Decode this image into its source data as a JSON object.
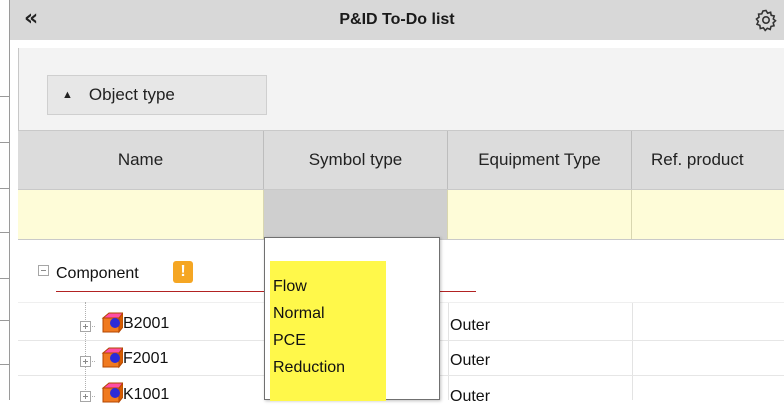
{
  "titlebar": {
    "title": "P&ID To-Do list",
    "collapse_icon": "«",
    "settings_icon": "gear-icon"
  },
  "group_button": {
    "label": "Object type",
    "caret_icon": "▲"
  },
  "columns": [
    "Name",
    "Symbol type",
    "Equipment Type",
    "Ref. product"
  ],
  "tree": {
    "group_label": "Component",
    "warning_symbol": "!",
    "rows": [
      {
        "name": "B2001",
        "equipment_type": "Outer"
      },
      {
        "name": "F2001",
        "equipment_type": "Outer"
      },
      {
        "name": "K1001",
        "equipment_type": "Outer"
      }
    ]
  },
  "dropdown": {
    "options": [
      "Flow",
      "Normal",
      "PCE",
      "Reduction"
    ]
  },
  "colors": {
    "filter_row": "#fefcd8",
    "options_highlight": "#fff84a",
    "warning": "#f5a623",
    "component_underline": "#b22222"
  }
}
